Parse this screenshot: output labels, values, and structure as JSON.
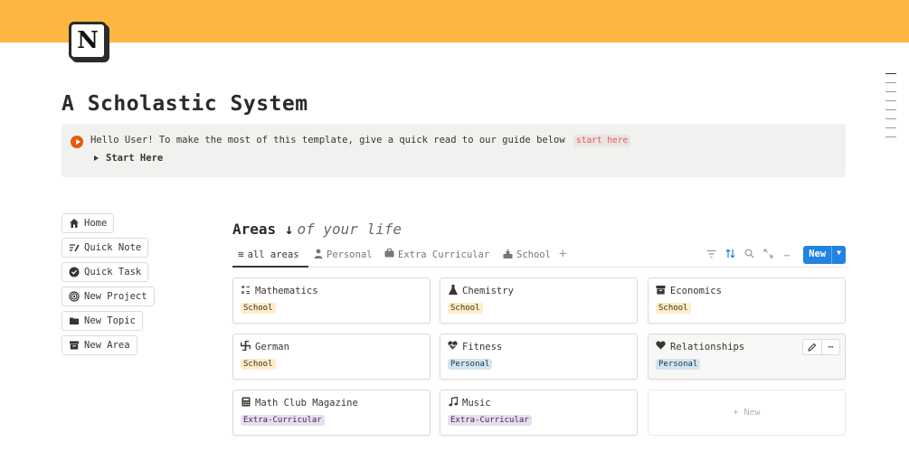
{
  "page": {
    "title": "A Scholastic System",
    "cover_color": "#fbb73f",
    "logo_letter": "N"
  },
  "callout": {
    "text": "Hello User! To make the most of this template, give a quick read to our guide below",
    "code": "start here",
    "toggle_label": "Start Here"
  },
  "sidebar": {
    "items": [
      {
        "label": "Home",
        "icon": "house-icon"
      },
      {
        "label": "Quick Note",
        "icon": "pen-lines-icon"
      },
      {
        "label": "Quick Task",
        "icon": "check-circle-icon"
      },
      {
        "label": "New Project",
        "icon": "target-icon"
      },
      {
        "label": "New Topic",
        "icon": "folder-icon"
      },
      {
        "label": "New Area",
        "icon": "archive-box-icon"
      }
    ]
  },
  "database": {
    "title": "Areas ↓",
    "subtitle": "of your life",
    "tabs": [
      {
        "label": "all areas",
        "icon": "stack-icon",
        "active": true
      },
      {
        "label": "Personal",
        "icon": "person-icon",
        "active": false
      },
      {
        "label": "Extra Curricular",
        "icon": "briefcase-icon",
        "active": false
      },
      {
        "label": "School",
        "icon": "school-icon",
        "active": false
      }
    ],
    "new_button": "New",
    "new_card": "+ New",
    "accent": "#2383e2"
  },
  "cards": [
    {
      "title": "Mathematics",
      "icon": "calculator-symbols-icon",
      "tag": "School",
      "tag_type": "school"
    },
    {
      "title": "Chemistry",
      "icon": "flask-icon",
      "tag": "School",
      "tag_type": "school"
    },
    {
      "title": "Economics",
      "icon": "archive-box-icon",
      "tag": "School",
      "tag_type": "school"
    },
    {
      "title": "German",
      "icon": "pinwheel-icon",
      "tag": "School",
      "tag_type": "school"
    },
    {
      "title": "Fitness",
      "icon": "heart-pulse-icon",
      "tag": "Personal",
      "tag_type": "personal"
    },
    {
      "title": "Relationships",
      "icon": "heart-icon",
      "tag": "Personal",
      "tag_type": "personal"
    },
    {
      "title": "Math Club Magazine",
      "icon": "calculator-icon",
      "tag": "Extra-Curricular",
      "tag_type": "extra"
    },
    {
      "title": "Music",
      "icon": "music-note-icon",
      "tag": "Extra-Curricular",
      "tag_type": "extra"
    }
  ]
}
